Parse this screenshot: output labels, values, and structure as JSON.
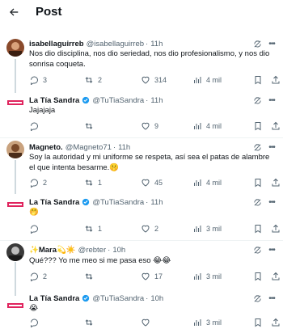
{
  "header": {
    "title": "Post"
  },
  "tweets": [
    {
      "name": "isabellaguirreb",
      "handle": "@isabellaguirreb",
      "time": "11h",
      "text": "Nos dio disciplina, nos dio seriedad, nos dio profesionalismo, y nos dio sonrisa coqueta.",
      "replies": "3",
      "reposts": "2",
      "likes": "314",
      "views": "4 mil"
    },
    {
      "name": "La Tía Sandra",
      "handle": "@TuTiaSandra",
      "time": "11h",
      "text": "Jajajaja",
      "replies": "",
      "reposts": "",
      "likes": "9",
      "views": "4 mil"
    },
    {
      "name": "Magneto.",
      "handle": "@Magneto71",
      "time": "11h",
      "text": "Soy la autoridad y mi uniforme se respeta, así sea el patas de alambre el que intenta besarme.🤫",
      "replies": "2",
      "reposts": "1",
      "likes": "45",
      "views": "4 mil"
    },
    {
      "name": "La Tía Sandra",
      "handle": "@TuTiaSandra",
      "time": "11h",
      "text": "🤭",
      "replies": "",
      "reposts": "1",
      "likes": "2",
      "views": "3 mil"
    },
    {
      "name": "✨Mara💫☀️",
      "handle": "@rebter",
      "time": "10h",
      "text": "Qué??? Yo me meo si me pasa eso 😂😂",
      "replies": "2",
      "reposts": "",
      "likes": "17",
      "views": "3 mil"
    },
    {
      "name": "La Tía Sandra",
      "handle": "@TuTiaSandra",
      "time": "10h",
      "text": "😭",
      "replies": "",
      "reposts": "",
      "likes": "",
      "views": "3 mil"
    }
  ],
  "colors": {
    "text": "#0f1419",
    "muted": "#536471",
    "verified": "#1d9bf0",
    "line": "#cfd9de",
    "avatar_brand": "#e0245e"
  }
}
